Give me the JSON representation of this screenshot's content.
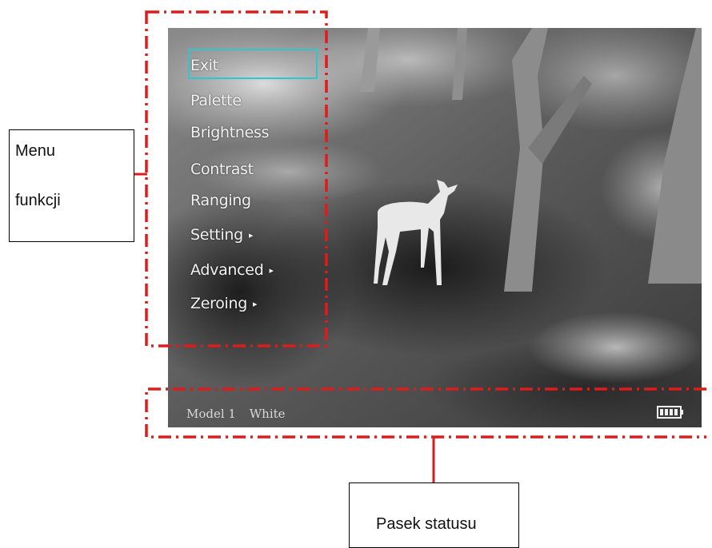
{
  "menu": {
    "items": [
      {
        "label": "Exit",
        "arrow": false,
        "selected": true
      },
      {
        "label": "Palette",
        "arrow": false,
        "selected": false
      },
      {
        "label": "Brightness",
        "arrow": false,
        "selected": false
      },
      {
        "label": "Contrast",
        "arrow": false,
        "selected": false
      },
      {
        "label": "Ranging",
        "arrow": false,
        "selected": false
      },
      {
        "label": "Setting",
        "arrow": true,
        "selected": false
      },
      {
        "label": "Advanced",
        "arrow": true,
        "selected": false
      },
      {
        "label": "Zeroing",
        "arrow": true,
        "selected": false
      }
    ],
    "arrow_glyph": "▸",
    "highlight_color": "#31c6cf"
  },
  "status_bar": {
    "model": "Model 1",
    "palette": "White",
    "battery_icon": "battery-full-icon"
  },
  "annotations": {
    "menu_label_line1": "Menu",
    "menu_label_line2": "funkcji",
    "status_label": "Pasek statusu",
    "dash_color": "#e01b1b"
  }
}
